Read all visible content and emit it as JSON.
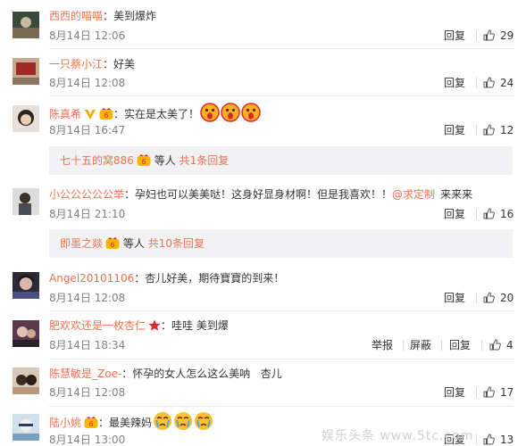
{
  "comments": [
    {
      "user": "西西的喵喵",
      "sep": "：",
      "text": "美到爆炸",
      "time": "8月14日 12:06",
      "reply": "回复",
      "likes": "29"
    },
    {
      "user": "一只蔡小江",
      "sep": "：",
      "text": "好美",
      "time": "8月14日 12:08",
      "reply": "回复",
      "likes": "24"
    },
    {
      "user": "陈真希",
      "sep": "：",
      "text": "实在是太美了！",
      "time": "8月14日 16:47",
      "reply": "回复",
      "likes": "12"
    },
    {
      "user": "小公公公公公举",
      "sep": "：",
      "text": "孕妇也可以美美哒！这身好显身材啊！但是我喜欢！！",
      "mention": "@求定制",
      "text2": "来来来",
      "time": "8月14日 21:10",
      "reply": "回复",
      "likes": "16"
    },
    {
      "user": "Angel20101106",
      "sep": "：",
      "text": "杏儿好美，期待寶寶的到来！",
      "time": "8月14日 12:08",
      "reply": "回复",
      "likes": "20"
    },
    {
      "user": "肥欢欢还是一枚杏仁",
      "sep": "：",
      "text": "哇哇 美到爆",
      "time": "8月14日 18:34",
      "report": "举报",
      "block": "屏蔽",
      "reply": "回复",
      "likes": "4"
    },
    {
      "user": "陈慧敏是_Zoe-",
      "sep": "：",
      "text": "怀孕的女人怎么这么美呐   杏儿",
      "time": "8月14日 12:08",
      "reply": "回复",
      "likes": "17"
    },
    {
      "user": "陆小姚",
      "sep": "：",
      "text": "最美辣妈",
      "time": "8月14日 13:00",
      "reply": "回复",
      "likes": "13"
    }
  ],
  "subreplies": [
    {
      "user": "七十五的窝886",
      "etc": "等人",
      "count": "共1条回复"
    },
    {
      "user": "即墨之燚",
      "etc": "等人",
      "count": "共10条回复"
    }
  ],
  "watermark": "娱乐头条 www.5tc.com",
  "colors": {
    "username": "#eb7350",
    "text": "#333333",
    "time": "#808080",
    "subreply_bg": "#f2f2f5"
  },
  "icons": [
    "avatar",
    "vip-badge-icon",
    "gold-v-icon",
    "red-star-icon",
    "thumb-up-icon",
    "surprised-face-icon",
    "crying-face-icon"
  ]
}
